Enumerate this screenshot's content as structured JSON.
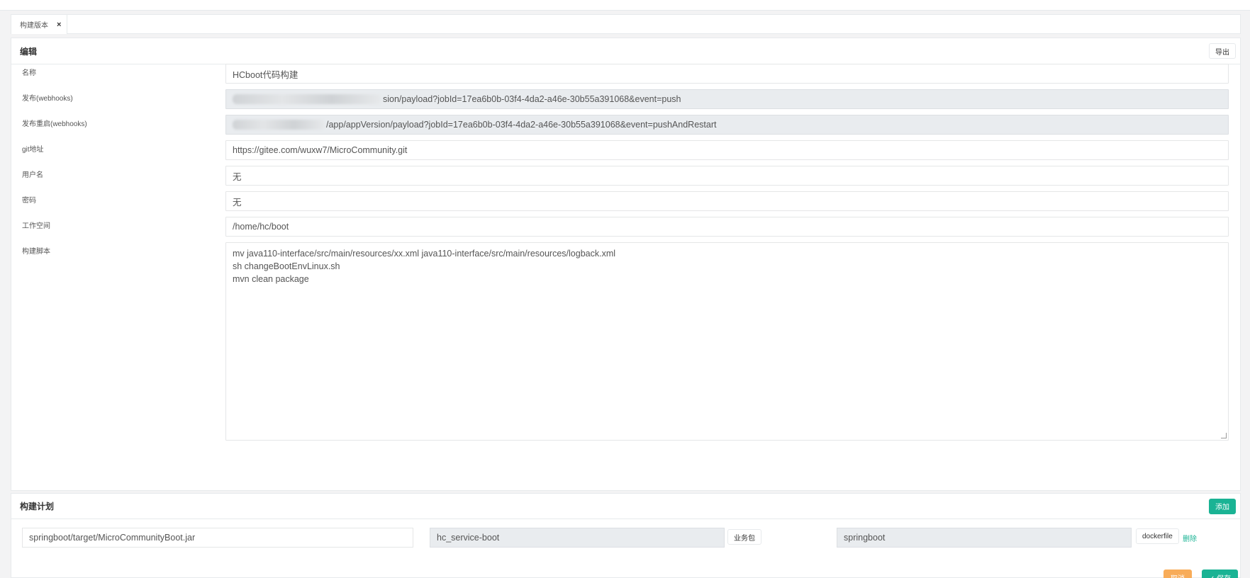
{
  "tab": {
    "label": "构建版本",
    "close": "×"
  },
  "edit_panel": {
    "title": "编辑",
    "export_label": "导出",
    "fields": {
      "name": {
        "label": "名称",
        "value": "HCboot代码构建"
      },
      "webhook": {
        "label": "发布(webhooks)",
        "value": "sion/payload?jobId=17ea6b0b-03f4-4da2-a46e-30b55a391068&event=push"
      },
      "webhook_restart": {
        "label": "发布重启(webhooks)",
        "value": "/app/appVersion/payload?jobId=17ea6b0b-03f4-4da2-a46e-30b55a391068&event=pushAndRestart"
      },
      "git_url": {
        "label": "git地址",
        "value": "https://gitee.com/wuxw7/MicroCommunity.git"
      },
      "username": {
        "label": "用户名",
        "value": "无"
      },
      "password": {
        "label": "密码",
        "value": "无"
      },
      "workspace": {
        "label": "工作空间",
        "value": "/home/hc/boot"
      },
      "script": {
        "label": "构建脚本",
        "value": "mv java110-interface/src/main/resources/xx.xml java110-interface/src/main/resources/logback.xml\nsh changeBootEnvLinux.sh\nmvn clean package"
      }
    }
  },
  "plan_panel": {
    "title": "构建计划",
    "add_label": "添加",
    "row": {
      "jar_path": "springboot/target/MicroCommunityBoot.jar",
      "service": "hc_service-boot",
      "service_button": "业务包",
      "docker_image": "springboot",
      "dockerfile_button": "dockerfile",
      "delete_label": "删除"
    }
  },
  "footer": {
    "cancel_label": "取消",
    "save_label": "✓ 保存"
  },
  "colors": {
    "accent": "#1ab394",
    "warning": "#f8ac59",
    "readonly_bg": "#e9ecef"
  }
}
